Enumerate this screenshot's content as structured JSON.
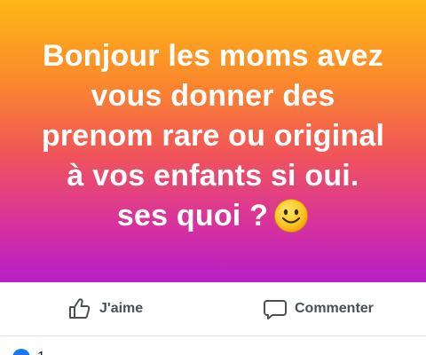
{
  "post": {
    "text_lines": [
      "Bonjour les moms avez",
      "vous donner des",
      "prenom rare ou original",
      "à vos enfants si oui.",
      "ses quoi ?"
    ],
    "emoji": "smiling-face-icon",
    "background_colors": [
      "#fdb716",
      "#fb8a2b",
      "#f0545a",
      "#d9339a",
      "#b61fc6"
    ]
  },
  "actions": {
    "like_label": "J'aime",
    "like_icon": "thumbs-up-icon",
    "comment_label": "Commenter",
    "comment_icon": "comment-bubble-icon"
  },
  "reactions": {
    "icon": "like-reaction-icon",
    "count": "1",
    "accent_color": "#1877f2"
  }
}
